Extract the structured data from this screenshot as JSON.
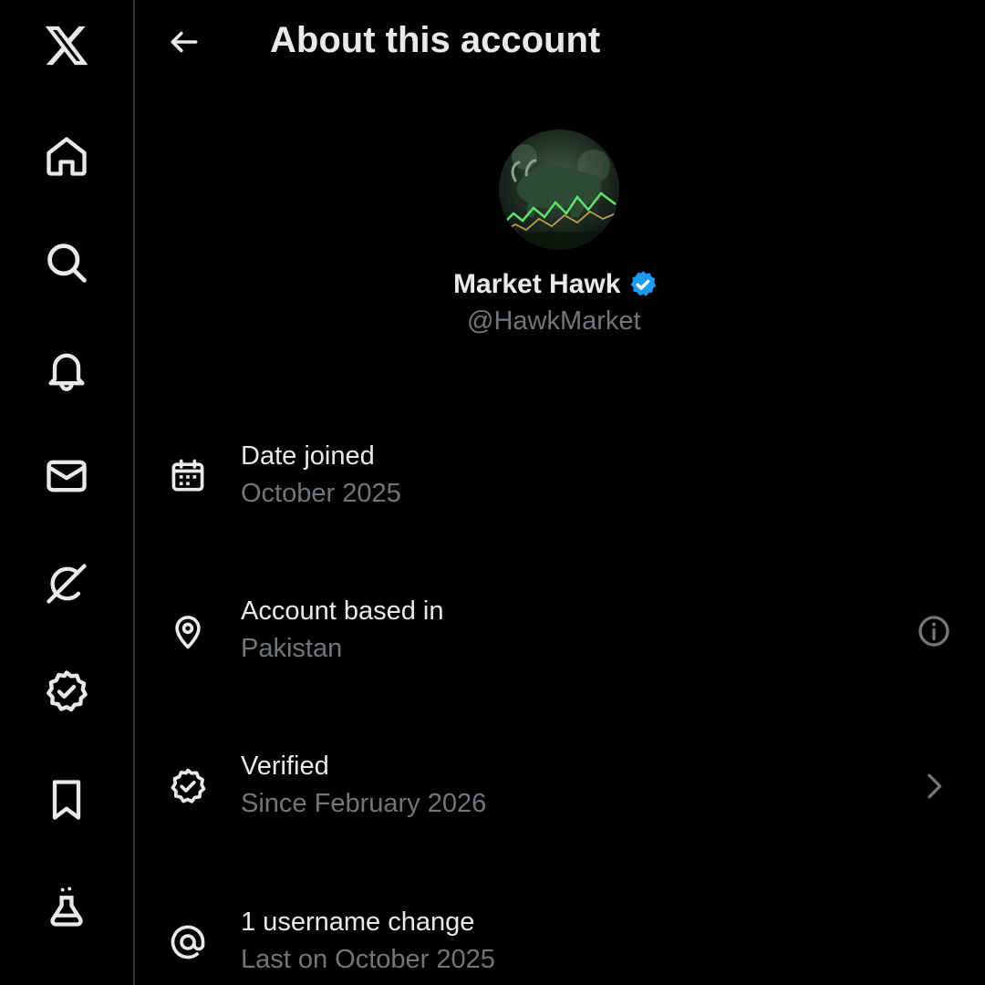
{
  "colors": {
    "background": "#000000",
    "primary_text": "#e7e9ea",
    "secondary_text": "#71767b",
    "divider": "#2f3336",
    "verified_blue": "#1d9bf0"
  },
  "sidebar": {
    "items": [
      {
        "name": "x-logo",
        "icon": "x-logo-icon"
      },
      {
        "name": "home",
        "icon": "home-icon"
      },
      {
        "name": "explore",
        "icon": "search-icon"
      },
      {
        "name": "notifications",
        "icon": "bell-icon"
      },
      {
        "name": "messages",
        "icon": "envelope-icon"
      },
      {
        "name": "grok",
        "icon": "grok-icon"
      },
      {
        "name": "verified",
        "icon": "verified-badge-icon"
      },
      {
        "name": "bookmarks",
        "icon": "bookmark-icon"
      },
      {
        "name": "labs",
        "icon": "flask-icon"
      }
    ]
  },
  "header": {
    "back_icon": "arrow-left-icon",
    "title": "About this account"
  },
  "profile": {
    "avatar": "bull-market-chart-avatar",
    "display_name": "Market Hawk",
    "verified": true,
    "handle": "@HawkMarket"
  },
  "details": [
    {
      "icon": "calendar-icon",
      "label": "Date joined",
      "value": "October 2025",
      "action_icon": ""
    },
    {
      "icon": "location-pin-icon",
      "label": "Account based in",
      "value": "Pakistan",
      "action_icon": "info-icon"
    },
    {
      "icon": "verified-badge-icon",
      "label": "Verified",
      "value": "Since February 2026",
      "action_icon": "chevron-right-icon"
    },
    {
      "icon": "at-sign-icon",
      "label": "1 username change",
      "value": "Last on October 2025",
      "action_icon": ""
    }
  ]
}
